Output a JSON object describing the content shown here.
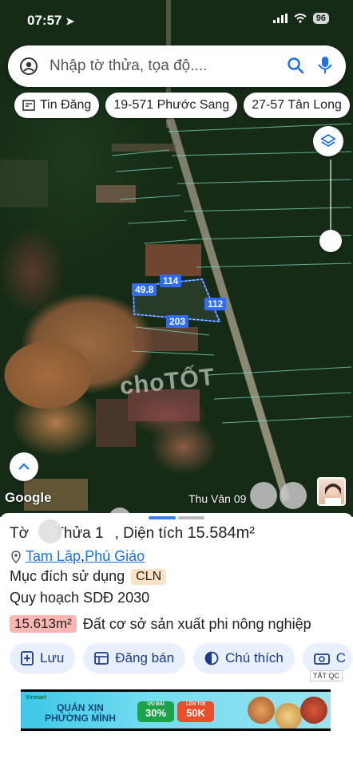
{
  "status_bar": {
    "time": "07:57",
    "battery": "96"
  },
  "search": {
    "placeholder": "Nhập tờ thửa, tọa độ...."
  },
  "chips": [
    {
      "label": "Tin Đăng"
    },
    {
      "label": "19-571 Phước Sang"
    },
    {
      "label": "27-57 Tân Long"
    }
  ],
  "map": {
    "watermark": "choTỐT",
    "google_logo": "Google",
    "attribution": "Thu Vân 09",
    "parcel_labels": {
      "top": "114",
      "left": "49.8",
      "right": "112",
      "bottom": "203"
    }
  },
  "sheet": {
    "title_prefix": "Tờ ",
    "title_mid": " Thửa 1",
    "title_suffix": ", Diện tích ",
    "title_area": "15.584m²",
    "location": {
      "commune": "Tam Lập",
      "separator": ", ",
      "district": "Phú Giáo"
    },
    "purpose_label": "Mục đích sử dụng",
    "purpose_code": "CLN",
    "plan_label": "Quy hoạch SDĐ 2030",
    "plan_area": "15.613m²",
    "plan_desc": "Đất cơ sở sản xuất phi nông nghiệp",
    "actions": [
      {
        "label": "Lưu"
      },
      {
        "label": "Đăng bán"
      },
      {
        "label": "Chú thích"
      },
      {
        "label": "C"
      }
    ],
    "ad_close": "TẮT QC"
  },
  "ad": {
    "brand": "Vinmart",
    "title_line1": "QUÁN XỊN",
    "title_line2": "PHƯỜNG MÌNH",
    "deal1_top": "ƯU ĐÃI",
    "deal1_value": "30%",
    "deal2_top": "LÊN TỚI",
    "deal2_value": "50K"
  },
  "colors": {
    "accent": "#1a73e8",
    "parcel_outline": "#2e6cf4",
    "cln_badge": "#fde3c3",
    "area_badge": "#f9b6b3"
  }
}
